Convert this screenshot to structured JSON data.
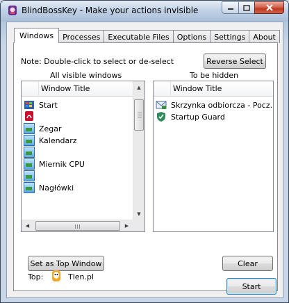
{
  "window": {
    "title": "BlindBossKey - Make your actions invisible"
  },
  "tabs": [
    "Windows",
    "Processes",
    "Executable Files",
    "Options",
    "Settings",
    "About"
  ],
  "note": "Note: Double-click to select or de-select",
  "reverse_select_label": "Reverse Select",
  "left_panel": {
    "heading": "All visible windows",
    "column": "Window Title",
    "items": [
      "Start",
      "",
      "Zegar",
      "Kalendarz",
      "",
      "Miernik CPU",
      "",
      "Nagłówki"
    ]
  },
  "right_panel": {
    "heading": "To be hidden",
    "column": "Window Title",
    "items": [
      "Skrzynka odbiorcza - Pocz...",
      "Startup Guard"
    ]
  },
  "set_top_label": "Set as Top Window",
  "clear_label": "Clear",
  "top": {
    "label": "Top:",
    "value": "Tlen.pl"
  },
  "start_label": "Start",
  "colors": {
    "accent": "#3c7fb1",
    "close": "#c0391f"
  }
}
